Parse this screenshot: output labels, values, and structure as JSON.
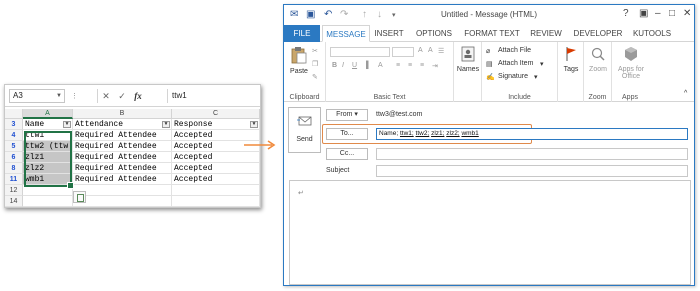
{
  "excel": {
    "name_box": "A3",
    "formula_value": "ttw1",
    "formula_icons": [
      "cancel-icon",
      "enter-icon",
      "fx-icon"
    ],
    "fx_label": "fx",
    "columns": [
      "A",
      "B",
      "C"
    ],
    "rows": [
      {
        "num": "3",
        "cells": [
          "Name",
          "Attendance",
          "Response"
        ],
        "header": true
      },
      {
        "num": "4",
        "cells": [
          "ttw1",
          "Required Attendee",
          "Accepted"
        ]
      },
      {
        "num": "5",
        "cells": [
          "ttw2 (ttw",
          "Required Attendee",
          "Accepted"
        ]
      },
      {
        "num": "6",
        "cells": [
          "zlz1",
          "Required Attendee",
          "Accepted"
        ]
      },
      {
        "num": "8",
        "cells": [
          "zlz2",
          "Required Attendee",
          "Accepted"
        ]
      },
      {
        "num": "11",
        "cells": [
          "wmb1",
          "Required Attendee",
          "Accepted"
        ]
      },
      {
        "num": "12",
        "cells": [
          "",
          "",
          ""
        ]
      },
      {
        "num": "14",
        "cells": [
          "",
          "",
          ""
        ]
      }
    ]
  },
  "outlook": {
    "title": "Untitled - Message (HTML)",
    "window_buttons": [
      "?",
      "▣",
      "–",
      "□",
      "✕"
    ],
    "tabs": [
      "FILE",
      "MESSAGE",
      "INSERT",
      "OPTIONS",
      "FORMAT TEXT",
      "REVIEW",
      "DEVELOPER",
      "KUTOOLS"
    ],
    "active_tab": "MESSAGE",
    "ribbon": {
      "clipboard": {
        "paste": "Paste",
        "label": "Clipboard"
      },
      "basic_text": {
        "label": "Basic Text",
        "bold": "B",
        "italic": "I",
        "underline": "U"
      },
      "names": {
        "button": "Names"
      },
      "include": {
        "label": "Include",
        "attach_file": "Attach File",
        "attach_item": "Attach Item",
        "signature": "Signature"
      },
      "tags": {
        "button": "Tags"
      },
      "zoom": {
        "button": "Zoom",
        "label": "Zoom"
      },
      "apps": {
        "button": "Apps for Office",
        "label": "Apps"
      }
    },
    "form": {
      "send": "Send",
      "from_button": "From",
      "from_value": "ttw3@test.com",
      "to_button": "To...",
      "to_prefix": "Name;",
      "to_names": [
        "ttw1;",
        "ttw2;",
        "zlz1;",
        "zlz2;",
        "wmb1"
      ],
      "cc_button": "Cc...",
      "subject_label": "Subject"
    },
    "highlight_color": "#e08a4b",
    "accent_color": "#2b79c2"
  }
}
